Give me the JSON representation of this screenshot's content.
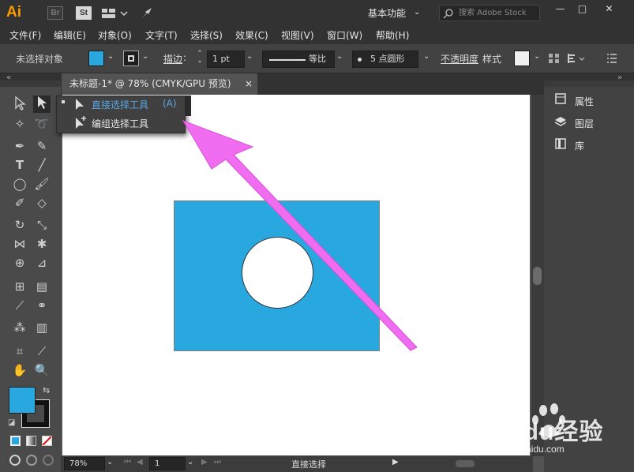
{
  "app": {
    "logo": "Ai",
    "br": "Br",
    "st": "St",
    "workspace": "基本功能",
    "search_placeholder": "搜索 Adobe Stock",
    "win_min": "—",
    "win_max": "□",
    "win_close": "✕"
  },
  "menu": [
    "文件(F)",
    "编辑(E)",
    "对象(O)",
    "文字(T)",
    "选择(S)",
    "效果(C)",
    "视图(V)",
    "窗口(W)",
    "帮助(H)"
  ],
  "control": {
    "no_selection": "未选择对象",
    "stroke_label": "描边",
    "stroke_value": "1 pt",
    "stroke_profile": "等比",
    "brush": "5 点圆形",
    "opacity_label": "不透明度",
    "style_label": "样式"
  },
  "tab": {
    "title": "未标题-1* @ 78% (CMYK/GPU 预览)",
    "close": "×"
  },
  "flyout": {
    "item1": "直接选择工具",
    "item1_key": "(A)",
    "item2": "编组选择工具"
  },
  "right_panel": {
    "properties": "属性",
    "layers": "图层",
    "library": "库"
  },
  "status": {
    "zoom": "78%",
    "page": "1",
    "tool": "直接选择"
  },
  "watermark": {
    "brand": "Baidu经验",
    "url": "jingyan.baidu.com"
  },
  "colors": {
    "fill": "#29a8e0",
    "arrow": "#f06cf0",
    "accent": "#5aa6e6"
  }
}
